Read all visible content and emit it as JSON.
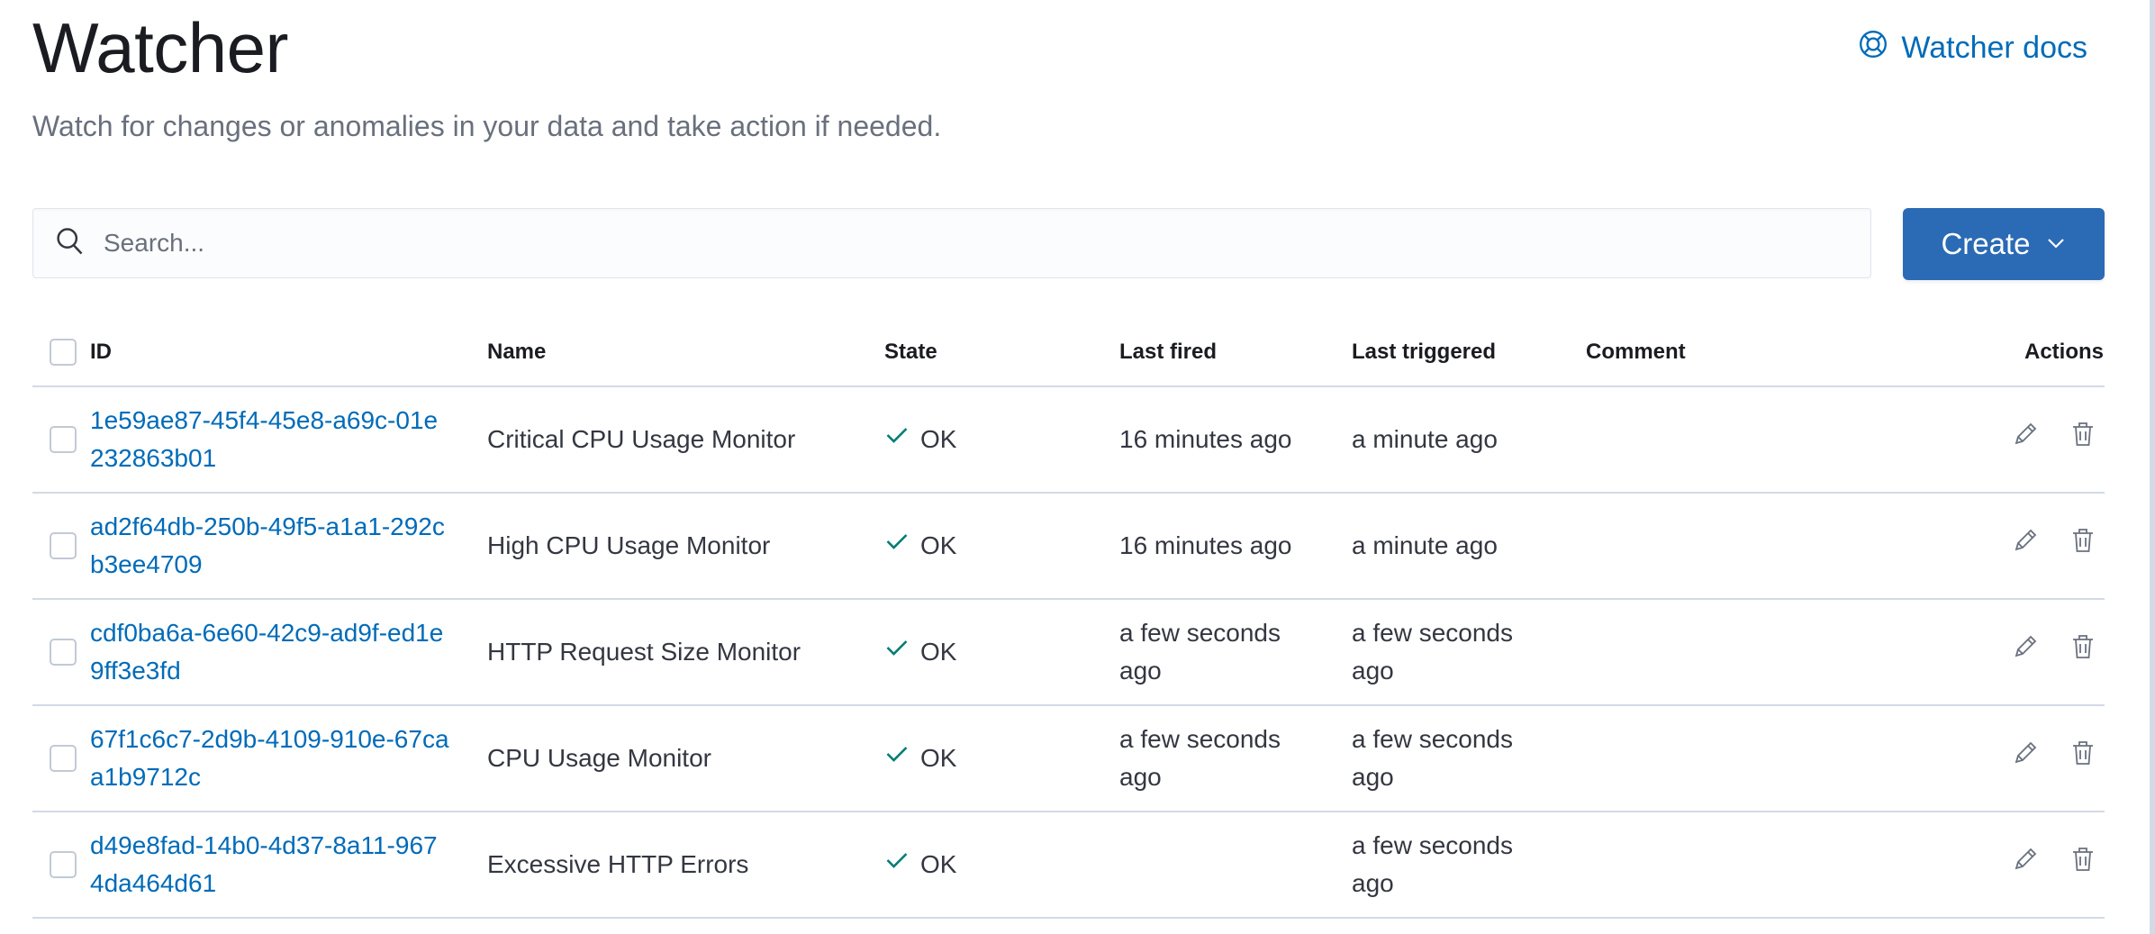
{
  "header": {
    "title": "Watcher",
    "description": "Watch for changes or anomalies in your data and take action if needed.",
    "docs_link": "Watcher docs"
  },
  "search": {
    "placeholder": "Search...",
    "value": ""
  },
  "create_button": {
    "label": "Create"
  },
  "table": {
    "columns": {
      "id": "ID",
      "name": "Name",
      "state": "State",
      "last_fired": "Last fired",
      "last_triggered": "Last triggered",
      "comment": "Comment",
      "actions": "Actions"
    },
    "rows": [
      {
        "id": "1e59ae87-45f4-45e8-a69c-01e232863b01",
        "name": "Critical CPU Usage Monitor",
        "state": "OK",
        "last_fired": "16 minutes ago",
        "last_triggered": "a minute ago",
        "comment": ""
      },
      {
        "id": "ad2f64db-250b-49f5-a1a1-292cb3ee4709",
        "name": "High CPU Usage Monitor",
        "state": "OK",
        "last_fired": "16 minutes ago",
        "last_triggered": "a minute ago",
        "comment": ""
      },
      {
        "id": "cdf0ba6a-6e60-42c9-ad9f-ed1e9ff3e3fd",
        "name": "HTTP Request Size Monitor",
        "state": "OK",
        "last_fired": "a few seconds ago",
        "last_triggered": "a few seconds ago",
        "comment": ""
      },
      {
        "id": "67f1c6c7-2d9b-4109-910e-67caa1b9712c",
        "name": "CPU Usage Monitor",
        "state": "OK",
        "last_fired": "a few seconds ago",
        "last_triggered": "a few seconds ago",
        "comment": ""
      },
      {
        "id": "d49e8fad-14b0-4d37-8a11-9674da464d61",
        "name": "Excessive HTTP Errors",
        "state": "OK",
        "last_fired": "",
        "last_triggered": "a few seconds ago",
        "comment": ""
      }
    ]
  },
  "icons": {
    "docs": "help-lifebuoy-icon",
    "search": "search-icon",
    "create_menu": "chevron-down-icon",
    "state_ok": "check-icon",
    "edit": "pencil-icon",
    "delete": "trash-icon"
  },
  "colors": {
    "link": "#006bb8",
    "primary_button": "#2b6bb5",
    "ok_check": "#017d73",
    "border": "#d3dae6"
  }
}
